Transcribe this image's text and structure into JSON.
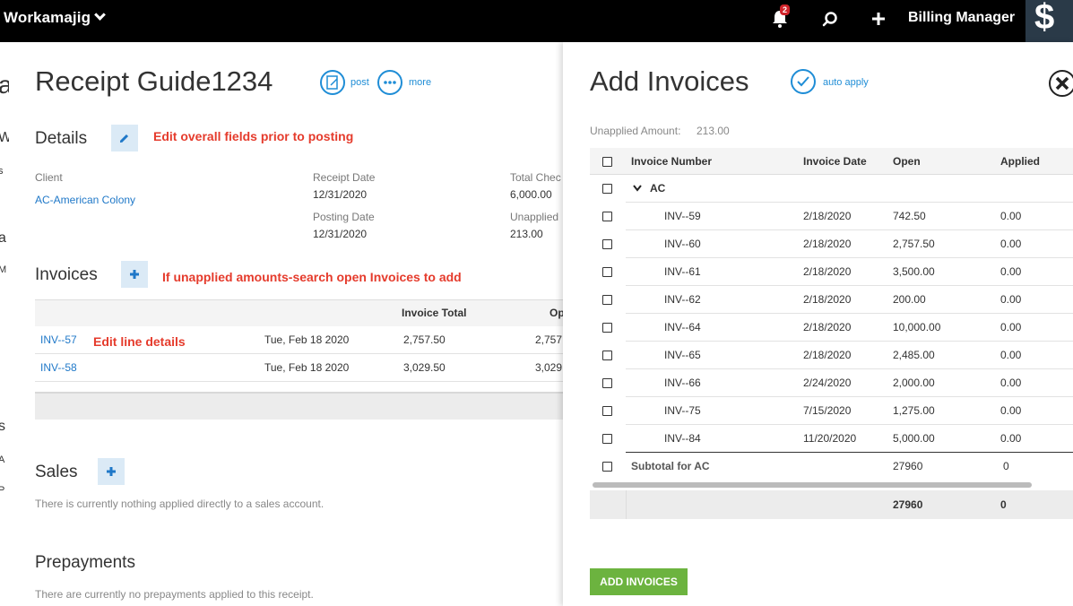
{
  "topbar": {
    "app_name": "Workamajig",
    "notifications_count": "2",
    "user_role": "Billing Manager",
    "dollar_glyph": "$"
  },
  "background_fragments": [
    "a",
    "W",
    "s",
    "a",
    "M",
    "s",
    "A",
    "P"
  ],
  "receipt": {
    "title": "Receipt Guide1234",
    "post_label": "post",
    "more_label": "more",
    "details_title": "Details",
    "details_annotation": "Edit overall fields prior to posting",
    "client_label": "Client",
    "client_value": "AC-American Colony",
    "receipt_date_label": "Receipt Date",
    "receipt_date_value": "12/31/2020",
    "posting_date_label": "Posting Date",
    "posting_date_value": "12/31/2020",
    "total_check_label": "Total Chec",
    "total_check_value": "6,000.00",
    "unapplied_label": "Unapplied",
    "unapplied_value": "213.00",
    "invoices_title": "Invoices",
    "invoices_annotation": "If unapplied amounts-search open Invoices to add",
    "line_annotation": "Edit line details",
    "invoice_table_headers": {
      "invoice_total": "Invoice Total",
      "open": "Op"
    },
    "invoice_rows": [
      {
        "number": "INV--57",
        "date": "Tue, Feb 18 2020",
        "total": "2,757.50",
        "open": "2,757"
      },
      {
        "number": "INV--58",
        "date": "Tue, Feb 18 2020",
        "total": "3,029.50",
        "open": "3,029"
      }
    ],
    "sales_title": "Sales",
    "sales_empty": "There is currently nothing applied directly to a sales account.",
    "prepayments_title": "Prepayments",
    "prepayments_empty": "There are currently no prepayments applied to this receipt."
  },
  "add_invoices": {
    "title": "Add Invoices",
    "auto_apply_label": "auto apply",
    "unapplied_label": "Unapplied Amount:",
    "unapplied_value": "213.00",
    "headers": {
      "number": "Invoice Number",
      "date": "Invoice Date",
      "open": "Open",
      "applied": "Applied"
    },
    "group_label": "AC",
    "rows": [
      {
        "number": "INV--59",
        "date": "2/18/2020",
        "open": "742.50",
        "applied": "0.00"
      },
      {
        "number": "INV--60",
        "date": "2/18/2020",
        "open": "2,757.50",
        "applied": "0.00"
      },
      {
        "number": "INV--61",
        "date": "2/18/2020",
        "open": "3,500.00",
        "applied": "0.00"
      },
      {
        "number": "INV--62",
        "date": "2/18/2020",
        "open": "200.00",
        "applied": "0.00"
      },
      {
        "number": "INV--64",
        "date": "2/18/2020",
        "open": "10,000.00",
        "applied": "0.00"
      },
      {
        "number": "INV--65",
        "date": "2/18/2020",
        "open": "2,485.00",
        "applied": "0.00"
      },
      {
        "number": "INV--66",
        "date": "2/24/2020",
        "open": "2,000.00",
        "applied": "0.00"
      },
      {
        "number": "INV--75",
        "date": "7/15/2020",
        "open": "1,275.00",
        "applied": "0.00"
      },
      {
        "number": "INV--84",
        "date": "11/20/2020",
        "open": "5,000.00",
        "applied": "0.00"
      }
    ],
    "subtotal_label": "Subtotal for AC",
    "subtotal_open": "27960",
    "subtotal_applied": "0",
    "total_open": "27960",
    "total_applied": "0",
    "add_button_label": "ADD INVOICES"
  },
  "colors": {
    "accent": "#1f8dd6",
    "annotation": "#e53b2c",
    "add_button": "#6cb33f",
    "topbar": "#000000"
  }
}
